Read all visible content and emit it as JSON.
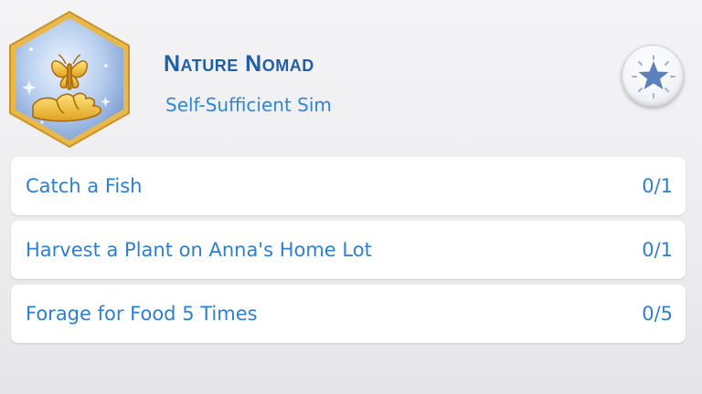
{
  "aspiration": {
    "title": "Nature Nomad",
    "subtitle": "Self-Sufficient Sim",
    "badge_icon": "butterfly-on-hand-icon",
    "favorite_icon": "star-icon"
  },
  "goals": [
    {
      "label": "Catch a Fish",
      "progress": "0/1",
      "done": 0,
      "total": 1
    },
    {
      "label": "Harvest a Plant on Anna's Home Lot",
      "progress": "0/1",
      "done": 0,
      "total": 1
    },
    {
      "label": "Forage for Food 5 Times",
      "progress": "0/5",
      "done": 0,
      "total": 5
    }
  ],
  "colors": {
    "title": "#1f5fa8",
    "text": "#2f7fd0",
    "badge_border": "#e8b84a",
    "badge_fill": "#a9c6ea",
    "icon_gold": "#f2c33a"
  }
}
